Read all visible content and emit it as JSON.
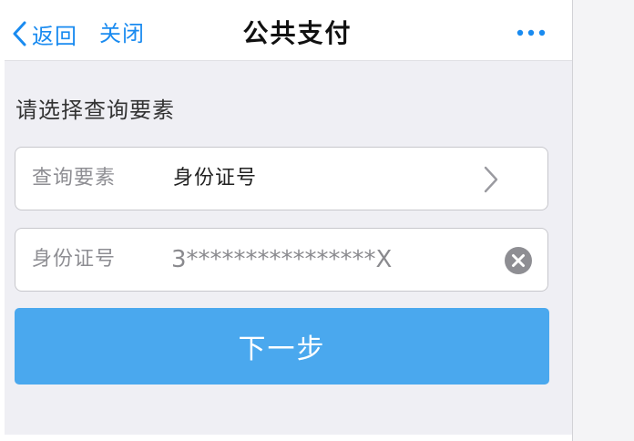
{
  "navbar": {
    "back_label": "返回",
    "close_label": "关闭",
    "title": "公共支付",
    "more_icon": "more-dots-icon"
  },
  "form": {
    "section_label": "请选择查询要素",
    "query_field": {
      "label": "查询要素",
      "value": "身份证号",
      "icon": "chevron-right-icon"
    },
    "id_field": {
      "label": "身份证号",
      "value": "3****************X",
      "clear_icon": "clear-icon"
    },
    "next_button_label": "下一步"
  },
  "colors": {
    "accent": "#1a8bf0",
    "button": "#4aa8ee",
    "background": "#efeff4",
    "clear_icon": "#8e8e93"
  }
}
